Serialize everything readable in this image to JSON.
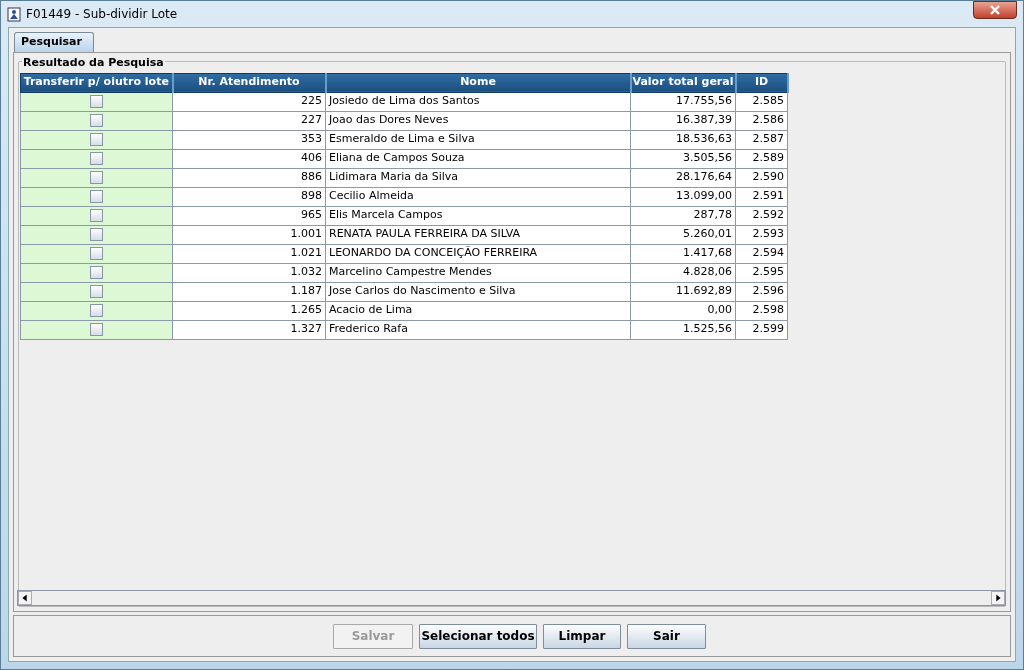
{
  "window": {
    "title": "F01449 - Sub-dividir Lote"
  },
  "tabs": [
    {
      "label": "Pesquisar",
      "selected": true
    }
  ],
  "group": {
    "title": "Resultado da Pesquisa"
  },
  "table": {
    "columns": [
      "Transferir p/ oiutro lote",
      "Nr. Atendimento",
      "Nome",
      "Valor total geral",
      "ID"
    ],
    "rows": [
      {
        "transferir": false,
        "nr_atendimento": "225",
        "nome": "Josiedo de Lima dos Santos",
        "valor_total_geral": "17.755,56",
        "id": "2.585"
      },
      {
        "transferir": false,
        "nr_atendimento": "227",
        "nome": "Joao das Dores Neves",
        "valor_total_geral": "16.387,39",
        "id": "2.586"
      },
      {
        "transferir": false,
        "nr_atendimento": "353",
        "nome": "Esmeraldo de Lima e Silva",
        "valor_total_geral": "18.536,63",
        "id": "2.587"
      },
      {
        "transferir": false,
        "nr_atendimento": "406",
        "nome": "Eliana de Campos Souza",
        "valor_total_geral": "3.505,56",
        "id": "2.589"
      },
      {
        "transferir": false,
        "nr_atendimento": "886",
        "nome": "Lidimara Maria da Silva",
        "valor_total_geral": "28.176,64",
        "id": "2.590"
      },
      {
        "transferir": false,
        "nr_atendimento": "898",
        "nome": "Cecilio Almeida",
        "valor_total_geral": "13.099,00",
        "id": "2.591"
      },
      {
        "transferir": false,
        "nr_atendimento": "965",
        "nome": "Elis Marcela Campos",
        "valor_total_geral": "287,78",
        "id": "2.592"
      },
      {
        "transferir": false,
        "nr_atendimento": "1.001",
        "nome": "RENATA PAULA FERREIRA DA SILVA",
        "valor_total_geral": "5.260,01",
        "id": "2.593"
      },
      {
        "transferir": false,
        "nr_atendimento": "1.021",
        "nome": "LEONARDO DA CONCEIÇÃO FERREIRA",
        "valor_total_geral": "1.417,68",
        "id": "2.594"
      },
      {
        "transferir": false,
        "nr_atendimento": "1.032",
        "nome": "Marcelino Campestre Mendes",
        "valor_total_geral": "4.828,06",
        "id": "2.595"
      },
      {
        "transferir": false,
        "nr_atendimento": "1.187",
        "nome": "Jose Carlos do Nascimento e Silva",
        "valor_total_geral": "11.692,89",
        "id": "2.596"
      },
      {
        "transferir": false,
        "nr_atendimento": "1.265",
        "nome": "Acacio de Lima",
        "valor_total_geral": "0,00",
        "id": "2.598"
      },
      {
        "transferir": false,
        "nr_atendimento": "1.327",
        "nome": "Frederico Rafa",
        "valor_total_geral": "1.525,56",
        "id": "2.599"
      }
    ]
  },
  "buttons": [
    {
      "label": "Salvar",
      "disabled": true
    },
    {
      "label": "Selecionar todos",
      "disabled": false
    },
    {
      "label": "Limpar",
      "disabled": false
    },
    {
      "label": "Sair",
      "disabled": false
    }
  ]
}
